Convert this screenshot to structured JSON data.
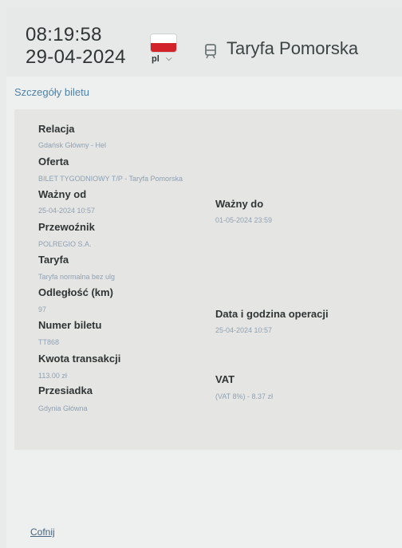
{
  "header": {
    "time": "08:19:58",
    "date": "29-04-2024",
    "language": "pl",
    "tariff_title": "Taryfa Pomorska",
    "icons": {
      "train": "train-icon",
      "language_dropdown": "chevron-down-icon"
    }
  },
  "section": {
    "title": "Szczegóły biletu"
  },
  "details": {
    "relacja": {
      "label": "Relacja",
      "value": "Gdańsk Główny - Hel"
    },
    "oferta": {
      "label": "Oferta",
      "value": "BILET TYGODNIOWY T/P - Taryfa Pomorska"
    },
    "wazny_od": {
      "label": "Ważny od",
      "value": "25-04-2024 10:57"
    },
    "wazny_do": {
      "label": "Ważny do",
      "value": "01-05-2024 23:59"
    },
    "przewoznik": {
      "label": "Przewoźnik",
      "value": "POLREGIO S.A."
    },
    "taryfa": {
      "label": "Taryfa",
      "value": "Taryfa normalna bez ulg"
    },
    "odleglosc": {
      "label": "Odległość (km)",
      "value": "97"
    },
    "data_operacji": {
      "label": "Data i godzina operacji",
      "value": "25-04-2024 10:57"
    },
    "numer_biletu": {
      "label": "Numer biletu",
      "value": "TT868"
    },
    "kwota": {
      "label": "Kwota transakcji",
      "value": "113.00 zł"
    },
    "vat": {
      "label": "VAT",
      "value": "(VAT 8%) - 8.37 zł"
    },
    "przesiadka": {
      "label": "Przesiadka",
      "value": "Gdynia Główna"
    }
  },
  "footer": {
    "back_label": "Cofnij"
  },
  "colors": {
    "accent": "#4f82a9",
    "value_text": "#8fa0b2",
    "flag_red": "#d2232a"
  }
}
